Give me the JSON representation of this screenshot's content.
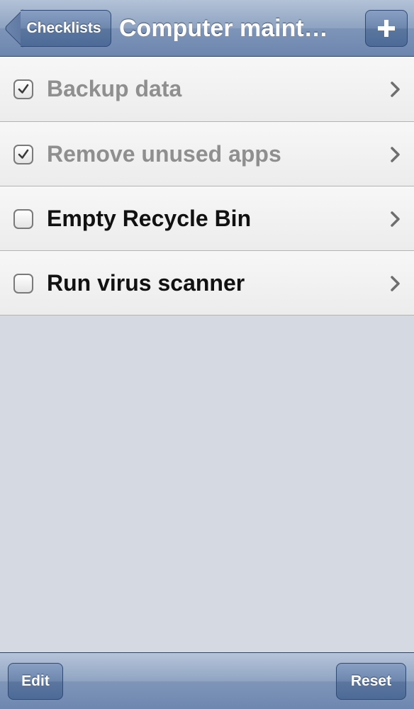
{
  "navbar": {
    "back_label": "Checklists",
    "title": "Computer maint…",
    "add_icon": "plus-icon"
  },
  "checklist": {
    "items": [
      {
        "label": "Backup data",
        "checked": true
      },
      {
        "label": "Remove unused apps",
        "checked": true
      },
      {
        "label": "Empty Recycle Bin",
        "checked": false
      },
      {
        "label": "Run virus scanner",
        "checked": false
      }
    ]
  },
  "toolbar": {
    "edit_label": "Edit",
    "reset_label": "Reset"
  },
  "colors": {
    "bar_blue": "#6d86ae",
    "done_text": "#8f8f8f",
    "open_text": "#111111",
    "background": "#d5d9e2"
  }
}
